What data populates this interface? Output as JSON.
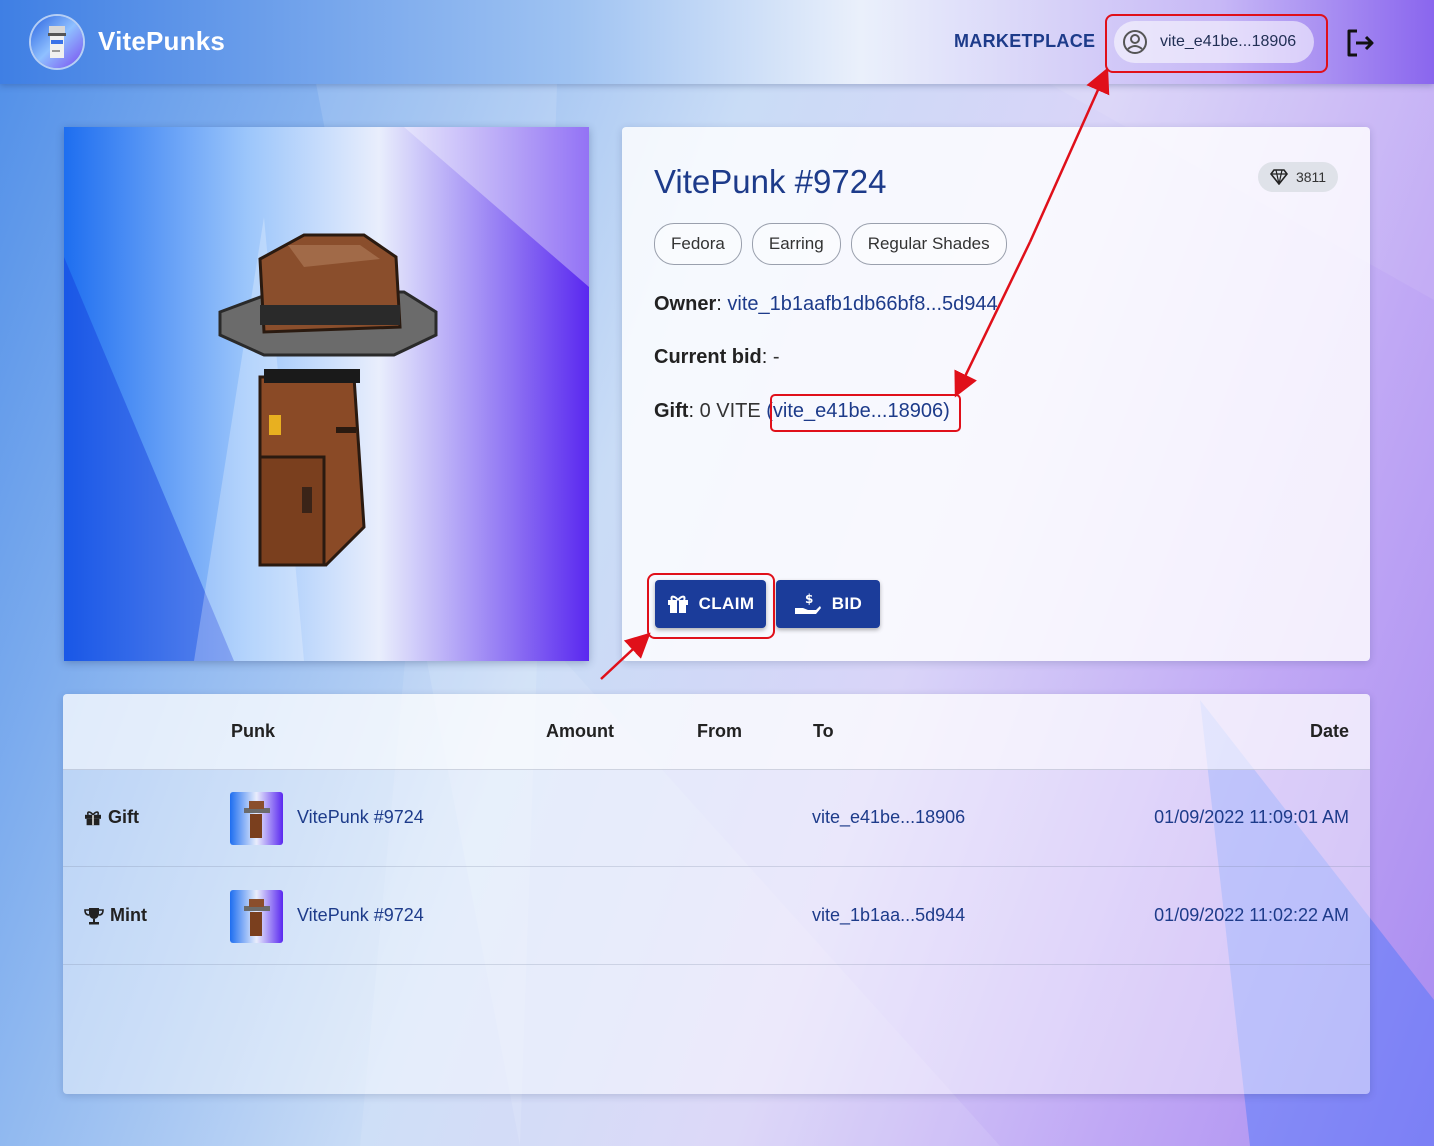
{
  "header": {
    "brand": "VitePunks",
    "nav_marketplace": "MARKETPLACE",
    "account_address": "vite_e41be...18906"
  },
  "punk": {
    "title": "VitePunk #9724",
    "rank": "3811",
    "traits": [
      "Fedora",
      "Earring",
      "Regular Shades"
    ],
    "owner_label": "Owner",
    "owner_value": "vite_1b1aafb1db66bf8...5d944",
    "bid_label": "Current bid",
    "bid_value": "-",
    "gift_label": "Gift",
    "gift_amount": "0 VITE",
    "gift_address": "(vite_e41be...18906)"
  },
  "actions": {
    "claim_label": "CLAIM",
    "bid_label": "BID"
  },
  "history": {
    "columns": [
      "Punk",
      "Amount",
      "From",
      "To",
      "Date"
    ],
    "rows": [
      {
        "type": "Gift",
        "punk": "VitePunk #9724",
        "amount": "",
        "from": "",
        "to": "vite_e41be...18906",
        "date": "01/09/2022 11:09:01 AM"
      },
      {
        "type": "Mint",
        "punk": "VitePunk #9724",
        "amount": "",
        "from": "",
        "to": "vite_1b1aa...5d944",
        "date": "01/09/2022 11:02:22 AM"
      }
    ]
  },
  "colors": {
    "primary": "#1b3c9a",
    "link": "#1d3b8a",
    "annotation": "#e0101a"
  }
}
